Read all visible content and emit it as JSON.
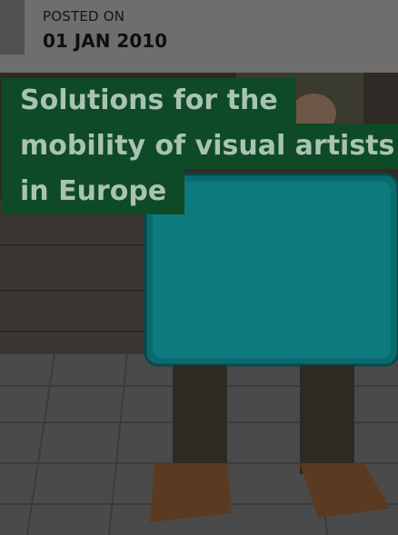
{
  "post": {
    "posted_label": "POSTED ON",
    "posted_date": "01 JAN 2010"
  },
  "article": {
    "title_lines": [
      "Solutions for the",
      "mobility of visual artists",
      "in Europe"
    ]
  },
  "colors": {
    "title_bg": "#0f4a26",
    "title_text": "#a9c3b2",
    "suitcase": "#0a6b6e"
  },
  "image": {
    "description_icon": "suitcase-photo-icon"
  }
}
